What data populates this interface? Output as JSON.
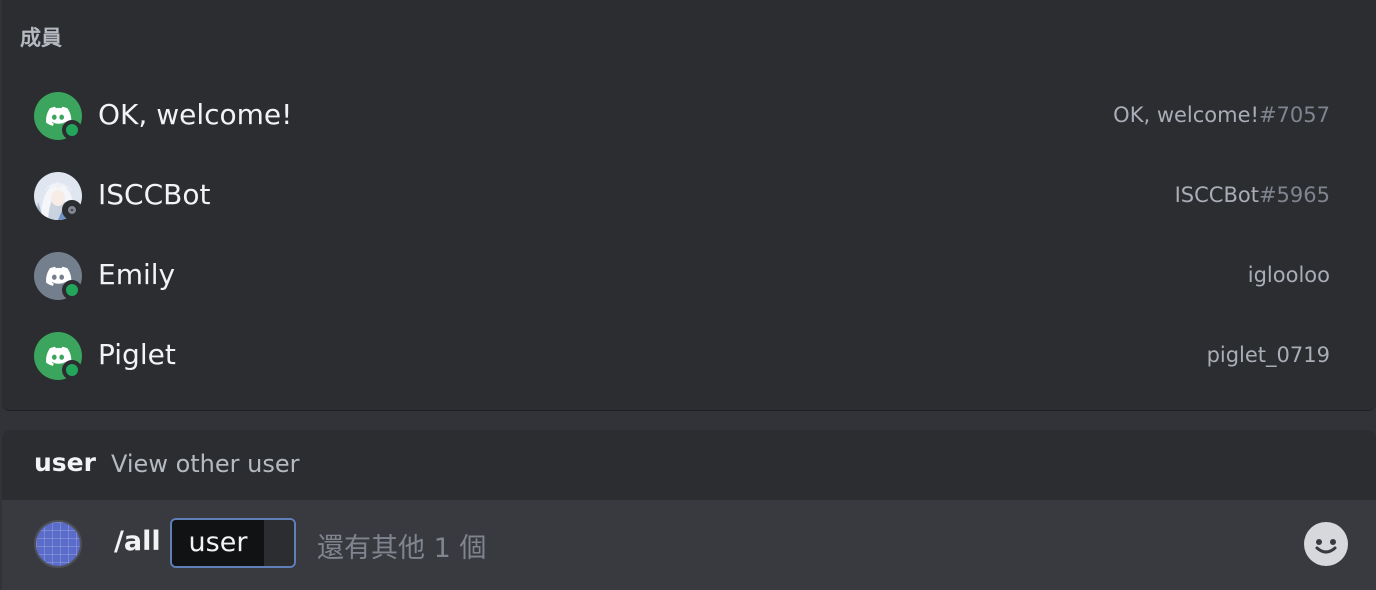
{
  "members": {
    "header": "成員",
    "items": [
      {
        "name": "OK, welcome!",
        "tag_user": "OK, welcome!",
        "tag_disc": "#7057",
        "status": "online",
        "avatar": "discord-logo-green"
      },
      {
        "name": "ISCCBot",
        "tag_user": "ISCCBot",
        "tag_disc": "#5965",
        "status": "offline",
        "avatar": "anime-character"
      },
      {
        "name": "Emily",
        "tag_user": "iglooloo",
        "tag_disc": "",
        "status": "online",
        "avatar": "discord-logo-grey"
      },
      {
        "name": "Piglet",
        "tag_user": "piglet_0719",
        "tag_disc": "",
        "status": "online",
        "avatar": "discord-logo-green"
      }
    ]
  },
  "command_option": {
    "name": "user",
    "description": "View other user"
  },
  "chat_input": {
    "command": "/all",
    "param_label": "user",
    "more_text": "還有其他 1 個"
  },
  "colors": {
    "online": "#23a55a",
    "background": "#313338",
    "panel": "#2b2d31"
  }
}
